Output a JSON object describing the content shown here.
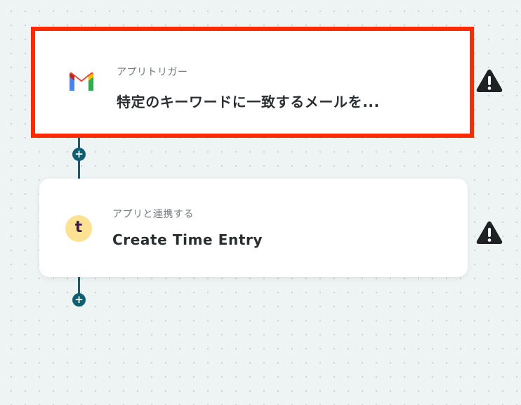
{
  "flow": {
    "steps": [
      {
        "type_label": "アプリトリガー",
        "title": "特定のキーワードに一致するメールを...",
        "app_icon": "gmail-icon",
        "selected": true,
        "warning_icon": "warning-icon"
      },
      {
        "type_label": "アプリと連携する",
        "title": "Create Time Entry",
        "app_icon": "toggl-icon",
        "app_icon_glyph": "t",
        "selected": false,
        "warning_icon": "warning-icon"
      }
    ],
    "add_step_glyph": "+",
    "colors": {
      "connector": "#0f5f73",
      "selection_border": "#ff2a00",
      "toggl_badge_bg": "#fde293",
      "toggl_badge_fg": "#3d1d47"
    }
  }
}
